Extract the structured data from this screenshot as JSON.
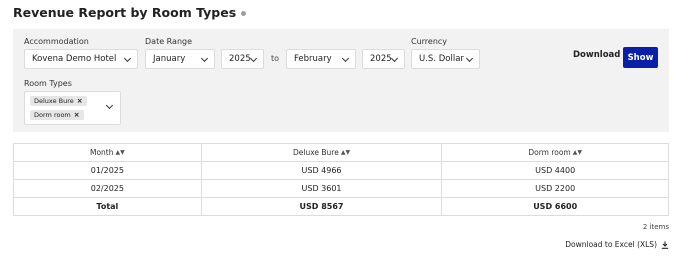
{
  "page": {
    "title": "Revenue Report by Room Types"
  },
  "filters": {
    "accommodation_label": "Accommodation",
    "accommodation_value": "Kovena Demo Hotel",
    "date_range_label": "Date Range",
    "start_month": "January",
    "start_year": "2025",
    "to_text": "to",
    "end_month": "February",
    "end_year": "2025",
    "currency_label": "Currency",
    "currency_value": "U.S. Dollar",
    "download_label": "Download",
    "show_label": "Show",
    "room_types_label": "Room Types",
    "room_types": [
      "Deluxe Bure",
      "Dorm room"
    ]
  },
  "table": {
    "headers": [
      "Month",
      "Deluxe Bure",
      "Dorm room"
    ],
    "rows": [
      [
        "01/2025",
        "USD 4966",
        "USD 4400"
      ],
      [
        "02/2025",
        "USD 3601",
        "USD 2200"
      ]
    ],
    "total": [
      "Total",
      "USD 8567",
      "USD 6600"
    ]
  },
  "footer": {
    "items_count": "2 items",
    "excel_label": "Download to Excel (XLS)"
  }
}
